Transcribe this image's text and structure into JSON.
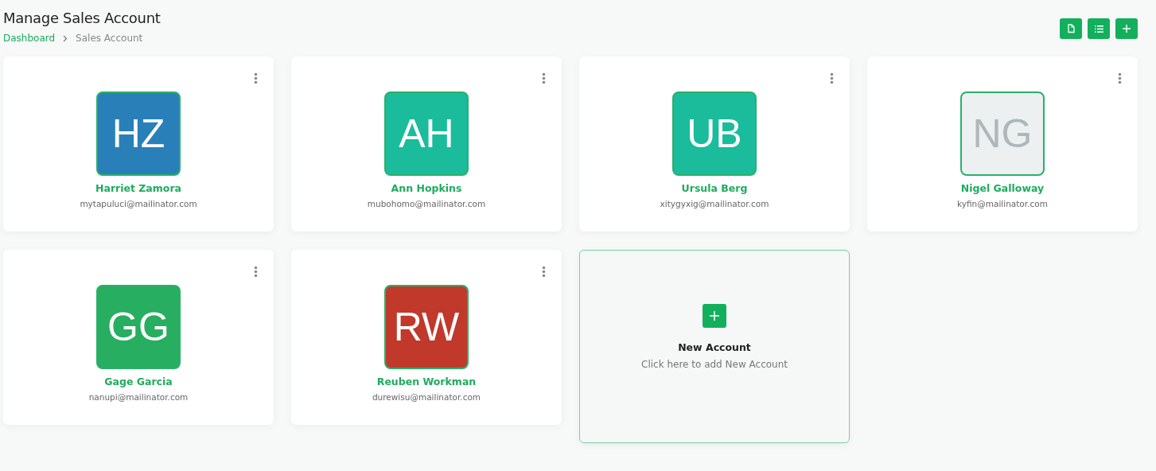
{
  "header": {
    "title": "Manage Sales Account",
    "breadcrumbs": [
      {
        "label": "Dashboard",
        "kind": "link"
      },
      {
        "label": "Sales Account",
        "kind": "current"
      }
    ]
  },
  "toolbar": [
    {
      "kind": "import"
    },
    {
      "kind": "list"
    },
    {
      "kind": "add"
    }
  ],
  "accounts": [
    {
      "initials": "HZ",
      "color": "#2980b9",
      "name": "Harriet Zamora",
      "email": "mytapuluci@mailinator.com"
    },
    {
      "initials": "AH",
      "color": "#1abc9c",
      "name": "Ann Hopkins",
      "email": "mubohomo@mailinator.com"
    },
    {
      "initials": "UB",
      "color": "#1abc9c",
      "name": "Ursula Berg",
      "email": "xitygyxig@mailinator.com"
    },
    {
      "initials": "NG",
      "color": "#ecf0f1",
      "name": "Nigel Galloway",
      "email": "kyfin@mailinator.com"
    },
    {
      "initials": "GG",
      "color": "#27ae60",
      "name": "Gage Garcia",
      "email": "nanupi@mailinator.com"
    },
    {
      "initials": "RW",
      "color": "#c0392b",
      "name": "Reuben Workman",
      "email": "durewisu@mailinator.com"
    }
  ],
  "new_account": {
    "title": "New Account",
    "subtitle": "Click here to add New Account"
  }
}
